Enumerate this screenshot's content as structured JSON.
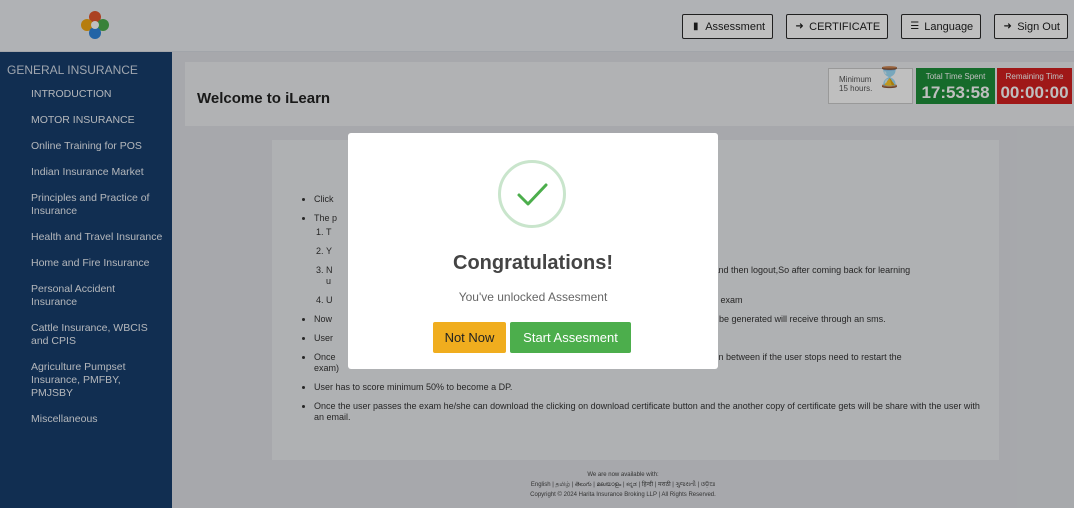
{
  "topbar": {
    "buttons": [
      {
        "label": "Assessment",
        "icon": "document-icon"
      },
      {
        "label": "CERTIFICATE",
        "icon": "signin-icon"
      },
      {
        "label": "Language",
        "icon": "translate-icon"
      },
      {
        "label": "Sign Out",
        "icon": "signout-icon"
      }
    ]
  },
  "sidebar": {
    "heading": "GENERAL INSURANCE",
    "items": [
      "INTRODUCTION",
      "MOTOR INSURANCE",
      "Online Training for POS",
      "Indian Insurance Market",
      "Principles and Practice of Insurance",
      "Health and Travel Insurance",
      "Home and Fire Insurance",
      "Personal Accident Insurance",
      "Cattle Insurance, WBCIS and CPIS",
      "Agriculture Pumpset Insurance, PMFBY, PMJSBY",
      "Miscellaneous"
    ]
  },
  "header": {
    "title": "Welcome to iLearn",
    "minimum_label": "Minimum",
    "minimum_value": "15 hours.",
    "spent_label": "Total Time Spent",
    "spent_value": "17:53:58",
    "remaining_label": "Remaining Time",
    "remaining_value": "00:00:00"
  },
  "content": {
    "bullets": [
      "Click",
      "The p",
      "Now",
      "User",
      "Once",
      "User has to score minimum 50% to become a DP.",
      "Once the user passes the exam he/she can download the clicking on download certificate button and the another copy of certificate gets will be share with the user with an email."
    ],
    "ordered": [
      "T",
      "Y",
      "N",
      "U"
    ],
    "right_fragments": {
      "n3": "ning and then logout,So after coming back for learning",
      "n3b": "u",
      "n4": "e final exam",
      "now": "tp will be generated will receive through an sms.",
      "once": "ams.(in between if the user stops need to restart the",
      "once2": "exam)"
    }
  },
  "footer": {
    "line1": "We are now available with:",
    "line2": "English | தமிழ் | తెలుగు | മലയാളം | ಕನ್ನಡ | हिन्दी | मराठी | ગુજરાતી | ଓଡ଼ିଆ",
    "line3": "Copyright © 2024 Harita Insurance Broking LLP | All Rights Reserved."
  },
  "modal": {
    "title": "Congratulations!",
    "subtitle": "You've unlocked Assesment",
    "not_now": "Not Now",
    "start": "Start Assesment"
  },
  "colors": {
    "sidebar": "#173e6c",
    "spent": "#1e8f3a",
    "remaining": "#d42121",
    "not_now": "#f0ad1e",
    "start": "#4cae4c",
    "check": "#4cae4c"
  }
}
